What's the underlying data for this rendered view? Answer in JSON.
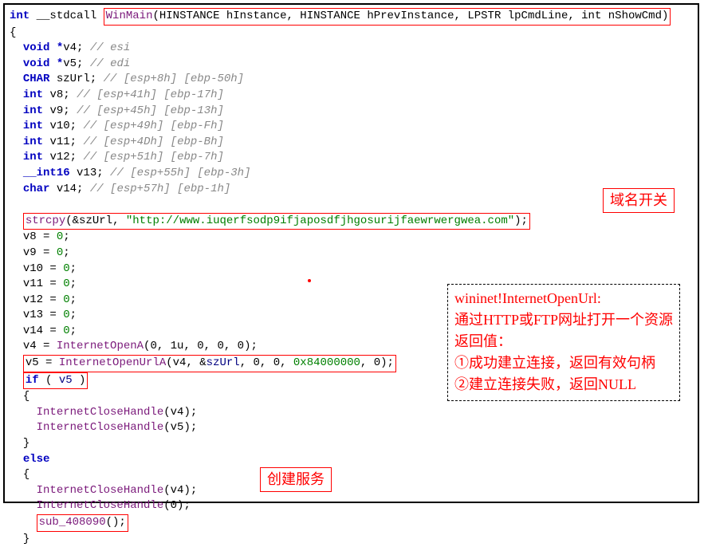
{
  "sig": {
    "ret": "int",
    "cc": "__stdcall",
    "name": "WinMain",
    "params": "(HINSTANCE hInstance, HINSTANCE hPrevInstance, LPSTR lpCmdLine, int nShowCmd)"
  },
  "decl": {
    "v4": {
      "t": "void *",
      "n": "v4;",
      "c": "// esi"
    },
    "v5": {
      "t": "void *",
      "n": "v5;",
      "c": "// edi"
    },
    "szUrl": {
      "t": "CHAR",
      "n": "szUrl;",
      "c": "// [esp+8h] [ebp-50h]"
    },
    "v8": {
      "t": "int",
      "n": "v8;",
      "c": "// [esp+41h] [ebp-17h]"
    },
    "v9": {
      "t": "int",
      "n": "v9;",
      "c": "// [esp+45h] [ebp-13h]"
    },
    "v10": {
      "t": "int",
      "n": "v10;",
      "c": "// [esp+49h] [ebp-Fh]"
    },
    "v11": {
      "t": "int",
      "n": "v11;",
      "c": "// [esp+4Dh] [ebp-Bh]"
    },
    "v12": {
      "t": "int",
      "n": "v12;",
      "c": "// [esp+51h] [ebp-7h]"
    },
    "v13": {
      "t": "__int16",
      "n": "v13;",
      "c": "// [esp+55h] [ebp-3h]"
    },
    "v14": {
      "t": "char",
      "n": "v14;",
      "c": "// [esp+57h] [ebp-1h]"
    }
  },
  "strcpy": {
    "fn": "strcpy",
    "a": "&szUrl",
    "s": "\"http://www.iuqerfsodp9ifjaposdfjhgosurijfaewrwergwea.com\"",
    "end": ");"
  },
  "assign": {
    "v8": "v8 = ",
    "v9": "v9 = ",
    "v10": "v10 = ",
    "v11": "v11 = ",
    "v12": "v12 = ",
    "v13": "v13 = ",
    "v14": "v14 = ",
    "zero": "0",
    "semi": ";"
  },
  "openA": {
    "lhs": "v4 = ",
    "fn": "InternetOpenA",
    "args": "(0, 1u, 0, 0, 0);"
  },
  "openUrl": {
    "lhs": "v5 = ",
    "fn": "InternetOpenUrlA",
    "pre": "(v4, &",
    "szUrl": "szUrl",
    "mid": ", 0, 0, ",
    "hex": "0x84000000",
    "post": ", 0);"
  },
  "ifline": {
    "kw": "if",
    "open": " ( ",
    "v": "v5",
    "close": " )"
  },
  "close1": {
    "fn": "InternetCloseHandle",
    "arg": "(v4);"
  },
  "close2": {
    "fn": "InternetCloseHandle",
    "arg": "(v5);"
  },
  "close3": {
    "fn": "InternetCloseHandle",
    "arg": "(v4);"
  },
  "close4": {
    "fn": "InternetCloseHandle",
    "arg": "(0);"
  },
  "else": "else",
  "sub": {
    "fn": "sub_408090",
    "args": "();"
  },
  "brace_open": "{",
  "brace_close": "}",
  "labels": {
    "domain": "域名开关",
    "create": "创建服务"
  },
  "panel": {
    "l1": "wininet!InternetOpenUrl:",
    "l2": "通过HTTP或FTP网址打开一个资源",
    "l3": "返回值：",
    "l4": "①成功建立连接，返回有效句柄",
    "l5": "②建立连接失败，返回NULL"
  }
}
